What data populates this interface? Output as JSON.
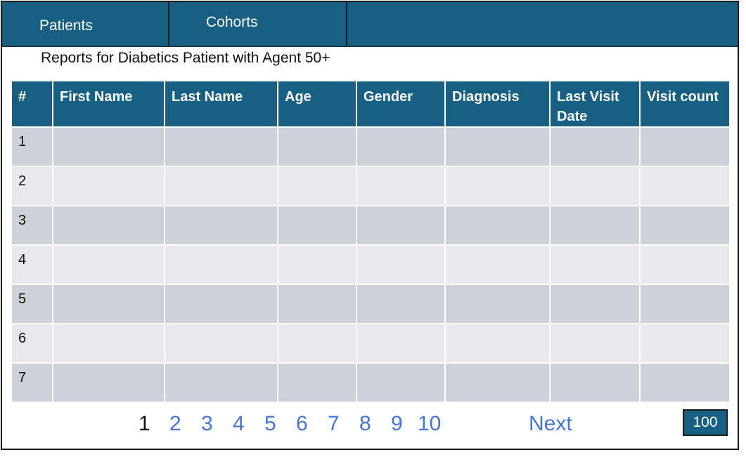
{
  "nav": {
    "tabs": [
      {
        "label": "Patients"
      },
      {
        "label": "Cohorts"
      }
    ]
  },
  "report": {
    "title": "Reports for Diabetics Patient with Agent 50+"
  },
  "table": {
    "columns": [
      "#",
      "First Name",
      "Last Name",
      "Age",
      "Gender",
      "Diagnosis",
      "Last Visit Date",
      "Visit count"
    ],
    "rows": [
      {
        "index": "1",
        "first_name": "",
        "last_name": "",
        "age": "",
        "gender": "",
        "diagnosis": "",
        "last_visit_date": "",
        "visit_count": ""
      },
      {
        "index": "2",
        "first_name": "",
        "last_name": "",
        "age": "",
        "gender": "",
        "diagnosis": "",
        "last_visit_date": "",
        "visit_count": ""
      },
      {
        "index": "3",
        "first_name": "",
        "last_name": "",
        "age": "",
        "gender": "",
        "diagnosis": "",
        "last_visit_date": "",
        "visit_count": ""
      },
      {
        "index": "4",
        "first_name": "",
        "last_name": "",
        "age": "",
        "gender": "",
        "diagnosis": "",
        "last_visit_date": "",
        "visit_count": ""
      },
      {
        "index": "5",
        "first_name": "",
        "last_name": "",
        "age": "",
        "gender": "",
        "diagnosis": "",
        "last_visit_date": "",
        "visit_count": ""
      },
      {
        "index": "6",
        "first_name": "",
        "last_name": "",
        "age": "",
        "gender": "",
        "diagnosis": "",
        "last_visit_date": "",
        "visit_count": ""
      },
      {
        "index": "7",
        "first_name": "",
        "last_name": "",
        "age": "",
        "gender": "",
        "diagnosis": "",
        "last_visit_date": "",
        "visit_count": ""
      }
    ]
  },
  "pagination": {
    "pages": [
      "1",
      "2",
      "3",
      "4",
      "5",
      "6",
      "7",
      "8",
      "9",
      "10"
    ],
    "current_page": "1",
    "next_label": "Next",
    "page_size": "100"
  },
  "colors": {
    "header_bg": "#176083",
    "row_odd": "#cdd1d8",
    "row_even": "#e7e9ec",
    "link": "#4576d6"
  }
}
